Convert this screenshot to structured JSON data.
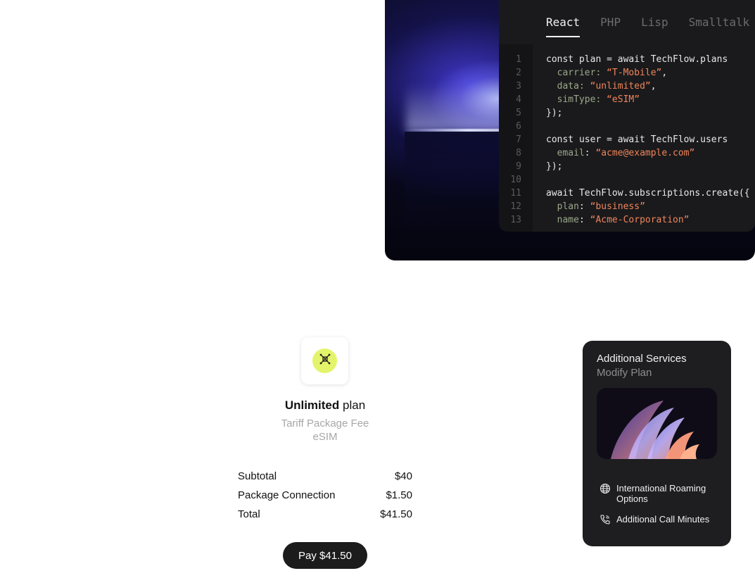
{
  "code_panel": {
    "tabs": [
      {
        "label": "React",
        "active": true
      },
      {
        "label": "PHP",
        "active": false
      },
      {
        "label": "Lisp",
        "active": false
      },
      {
        "label": "Smalltalk",
        "active": false
      }
    ],
    "line_numbers": [
      "1",
      "2",
      "3",
      "4",
      "5",
      "6",
      "7",
      "8",
      "9",
      "10",
      "11",
      "12",
      "13"
    ],
    "lines": [
      [
        {
          "t": "const plan = await TechFlow.plans",
          "c": ""
        }
      ],
      [
        {
          "t": "  carrier: ",
          "c": "k"
        },
        {
          "t": "“T-Mobile”",
          "c": "s"
        },
        {
          "t": ",",
          "c": ""
        }
      ],
      [
        {
          "t": "  data: ",
          "c": "k"
        },
        {
          "t": "“unlimited”",
          "c": "s"
        },
        {
          "t": ",",
          "c": ""
        }
      ],
      [
        {
          "t": "  simType: ",
          "c": "k"
        },
        {
          "t": "“eSIM”",
          "c": "s"
        }
      ],
      [
        {
          "t": "});",
          "c": ""
        }
      ],
      [
        {
          "t": "",
          "c": ""
        }
      ],
      [
        {
          "t": "const user = await TechFlow.users",
          "c": ""
        }
      ],
      [
        {
          "t": "  email",
          "c": "k"
        },
        {
          "t": ": ",
          "c": ""
        },
        {
          "t": "“acme@example.com”",
          "c": "s"
        }
      ],
      [
        {
          "t": "});",
          "c": ""
        }
      ],
      [
        {
          "t": "",
          "c": ""
        }
      ],
      [
        {
          "t": "await TechFlow.subscriptions.create({",
          "c": ""
        }
      ],
      [
        {
          "t": "  plan",
          "c": "k"
        },
        {
          "t": ": ",
          "c": ""
        },
        {
          "t": "“business”",
          "c": "s"
        }
      ],
      [
        {
          "t": "  name",
          "c": "k"
        },
        {
          "t": ": ",
          "c": ""
        },
        {
          "t": "“Acme-Corporation”",
          "c": "s"
        }
      ]
    ]
  },
  "checkout": {
    "plan_name_bold": "Unlimited",
    "plan_name_rest": " plan",
    "subtitle_line1": "Tariff Package Fee",
    "subtitle_line2": "eSIM",
    "rows": [
      {
        "label": "Subtotal",
        "value": "$40"
      },
      {
        "label": "Package Connection",
        "value": "$1.50"
      },
      {
        "label": "Total",
        "value": "$41.50"
      }
    ],
    "pay_label": "Pay $41.50",
    "icon": "network-nodes-icon",
    "accent_color": "#e4f46a"
  },
  "services": {
    "title": "Additional Services",
    "subtitle": "Modify Plan",
    "items": [
      {
        "label": "International Roaming Options",
        "icon": "globe-icon"
      },
      {
        "label": "Additional Call Minutes",
        "icon": "phone-icon"
      }
    ]
  }
}
